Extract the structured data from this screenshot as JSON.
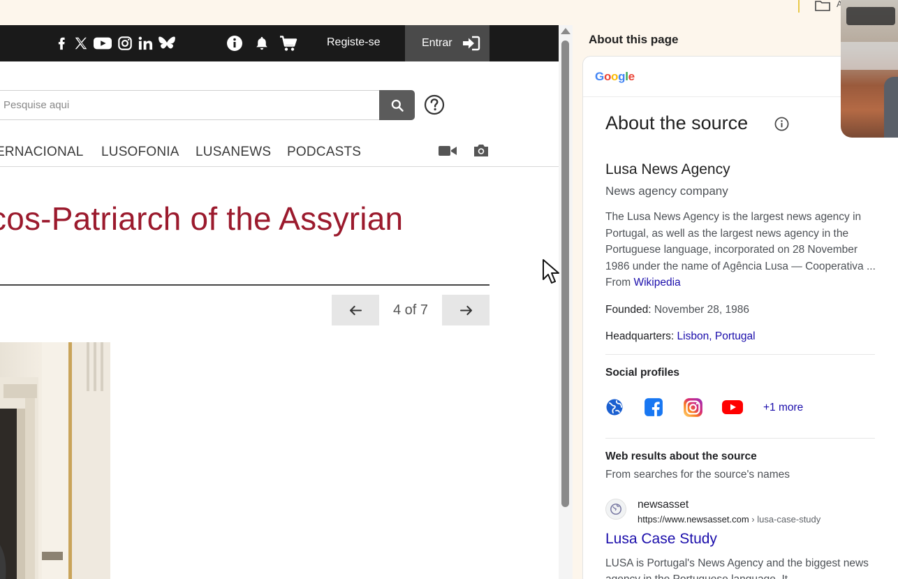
{
  "toolbar": {
    "folder_label": "A"
  },
  "site": {
    "social_icons": [
      "facebook-icon",
      "x-icon",
      "youtube-icon",
      "instagram-icon",
      "linkedin-icon",
      "bluesky-icon"
    ],
    "register_label": "Registe-se",
    "login_label": "Entrar",
    "search": {
      "placeholder": "Pesquise aqui"
    },
    "nav": [
      "ERNACIONAL",
      "LUSOFONIA",
      "LUSANEWS",
      "PODCASTS"
    ],
    "article_title": "cos-Patriarch of the Assyrian",
    "pagination": {
      "counter": "4 of 7"
    }
  },
  "panel": {
    "heading": "About this page",
    "google_logo": "Google",
    "source_heading": "About the source",
    "entity": {
      "name": "Lusa News Agency",
      "type": "News agency company",
      "description": "The Lusa News Agency is the largest news agency in Portugal, as well as the largest news agency in the Portuguese language, incorporated on 28 November 1986 under the name of Agência Lusa — Cooperativa ... From",
      "description_link": "Wikipedia",
      "founded_label": "Founded:",
      "founded_value": "November 28, 1986",
      "hq_label": "Headquarters:",
      "hq_city": "Lisbon",
      "hq_sep": ",",
      "hq_country": "Portugal"
    },
    "social": {
      "heading": "Social profiles",
      "more": "+1 more"
    },
    "web": {
      "heading": "Web results about the source",
      "sub": "From searches for the source's names",
      "result": {
        "site": "newsasset",
        "url_host": "https://www.newsasset.com",
        "url_path": " › lusa-case-study",
        "title": "Lusa Case Study",
        "snippet": "LUSA is Portugal's News Agency and the biggest news agency in the Portuguese language. It..."
      }
    }
  },
  "colors": {
    "title_red": "#9b1a2d",
    "link_blue": "#1a0dab",
    "topbar": "#1a1a1a"
  }
}
